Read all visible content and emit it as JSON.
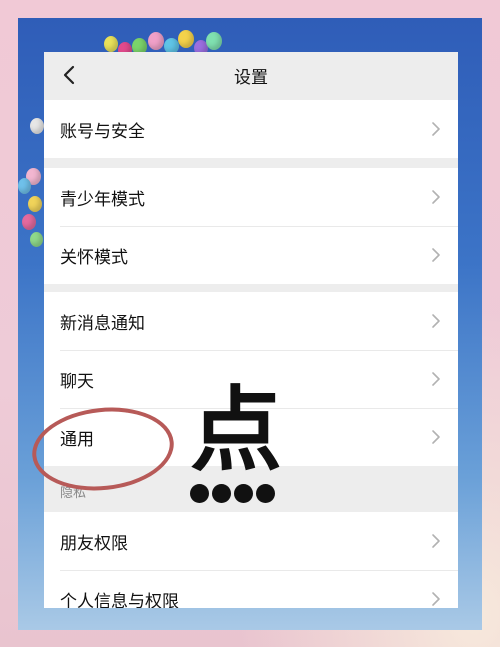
{
  "nav": {
    "title": "设置"
  },
  "groups": [
    {
      "items": [
        {
          "label": "账号与安全"
        }
      ]
    },
    {
      "items": [
        {
          "label": "青少年模式"
        },
        {
          "label": "关怀模式"
        }
      ]
    },
    {
      "items": [
        {
          "label": "新消息通知"
        },
        {
          "label": "聊天"
        },
        {
          "label": "通用"
        }
      ]
    },
    {
      "header": "隐私",
      "items": [
        {
          "label": "朋友权限"
        },
        {
          "label": "个人信息与权限"
        }
      ]
    }
  ],
  "overlay": {
    "glyph": "点"
  },
  "colors": {
    "annotation": "#b75a58",
    "background": "#ededed"
  }
}
